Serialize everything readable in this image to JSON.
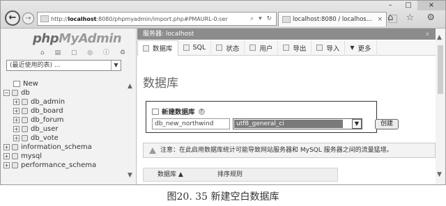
{
  "browser": {
    "address_prefix": "http://",
    "address_host": "localhost",
    "address_rest": ":8080/phpmyadmin/import.php#PMAURL-0:ser",
    "address_icons": "⌕ ▾ ↻",
    "tab_title": "localhost:8080 / localhos...",
    "tab_close": "×",
    "window_controls": [
      "–",
      "□",
      "×"
    ],
    "chrome_icons": "⌂ ☆ ⚙"
  },
  "nav": {
    "logo_php": "php",
    "logo_my": "MyAdmin",
    "icons": "⌂ ▤ ▢ ◎ ⓘ ♻",
    "recent_select": "(最近使用的表) ...",
    "tree": [
      {
        "label": "New",
        "expander": "",
        "icon": "new",
        "indent": 14
      },
      {
        "label": "db",
        "expander": "−",
        "icon": "db",
        "indent": 0
      },
      {
        "label": "db_admin",
        "expander": "+",
        "icon": "db",
        "indent": 14
      },
      {
        "label": "db_board",
        "expander": "+",
        "icon": "db",
        "indent": 14
      },
      {
        "label": "db_forum",
        "expander": "+",
        "icon": "db",
        "indent": 14
      },
      {
        "label": "db_user",
        "expander": "+",
        "icon": "db",
        "indent": 14
      },
      {
        "label": "db_vote",
        "expander": "+",
        "icon": "db",
        "indent": 14
      },
      {
        "label": "information_schema",
        "expander": "+",
        "icon": "db",
        "indent": 0
      },
      {
        "label": "mysql",
        "expander": "+",
        "icon": "db",
        "indent": 0
      },
      {
        "label": "performance_schema",
        "expander": "+",
        "icon": "db",
        "indent": 0
      }
    ]
  },
  "main": {
    "breadcrumb": "服务器: localhost",
    "breadcrumb_ctl": "⌅",
    "tabs": [
      "数据库",
      "SQL",
      "状态",
      "用户",
      "导出",
      "导入",
      "更多"
    ],
    "more_prefix": "▼",
    "heading": "数据库",
    "create": {
      "title": "新建数据库",
      "help": "?",
      "db_name_value": "db_new_northwind",
      "collation_value": "utf8_general_ci",
      "create_button": "创建"
    },
    "notice": "注意：在此启用数据库统计可能导致网站服务器和 MySQL 服务器之间的流量猛增。",
    "table_header": [
      "数据库 ▲",
      "排序规则"
    ]
  },
  "caption": "图20. 35   新建空白数据库"
}
